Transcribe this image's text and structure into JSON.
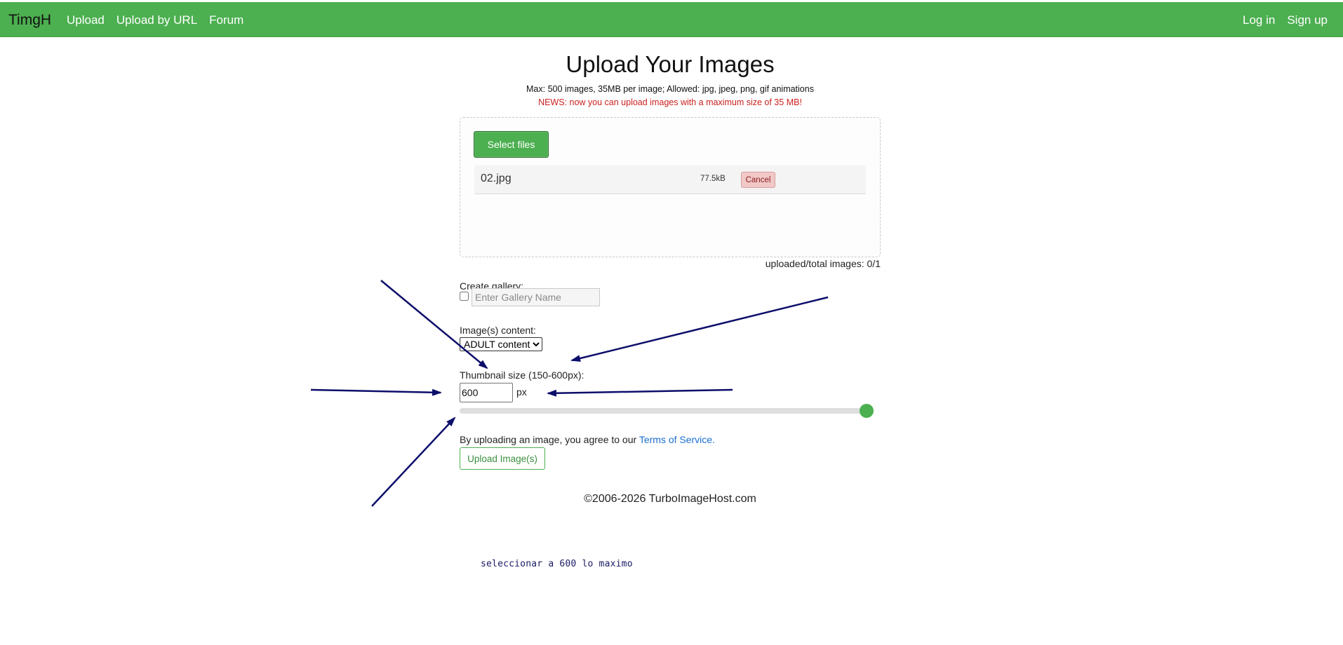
{
  "navbar": {
    "brand": "TimgH",
    "left_links": [
      "Upload",
      "Upload by URL",
      "Forum"
    ],
    "right_links": [
      "Log in",
      "Sign up"
    ],
    "color": "#4caf50"
  },
  "main": {
    "title": "Upload Your Images",
    "limits": "Max: 500 images, 35MB per image; Allowed: jpg, jpeg, png, gif animations",
    "news": "NEWS: now you can upload images with a maximum size of 35 MB!",
    "select_button": "Select files",
    "file": {
      "name": "02.jpg",
      "size": "77.5kB",
      "cancel_label": "Cancel"
    },
    "counter": "uploaded/total images: 0/1",
    "gallery": {
      "label": "Create gallery:",
      "placeholder": "Enter Gallery Name",
      "checked": false
    },
    "content": {
      "label": "Image(s) content:",
      "selected": "ADULT content"
    },
    "thumbnail": {
      "label": "Thumbnail size (150-600px):",
      "value": "600",
      "unit": "px",
      "min": 150,
      "max": 600
    },
    "agreement": {
      "text": "By uploading an image, you agree to our ",
      "link": "Terms of Service."
    },
    "upload_button": "Upload Image(s)",
    "copyright": "©2006-2026 TurboImageHost.com"
  },
  "annotation": {
    "note": "seleccionar a 600 lo maximo",
    "arrow_color": "#0d0d6b"
  }
}
